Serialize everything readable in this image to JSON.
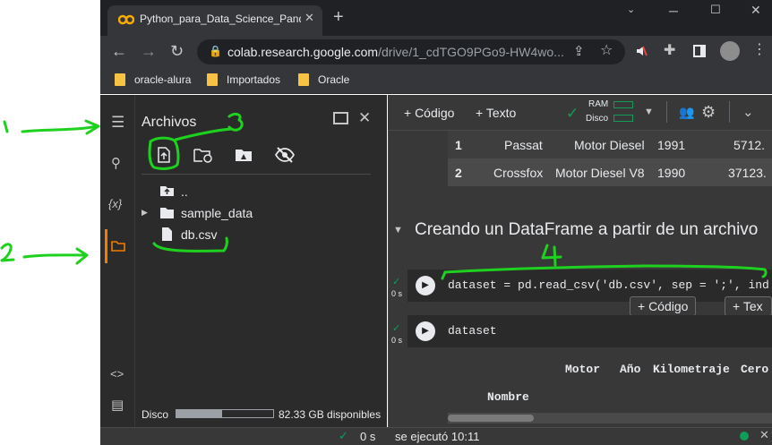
{
  "browser": {
    "tab_title": "Python_para_Data_Science_Pandas",
    "new_tab": "+",
    "url_host": "colab.research.google.com",
    "url_path": "/drive/1_cdTGO9PGo9-HW4wo...",
    "bookmarks": [
      "oracle-alura",
      "Importados",
      "Oracle"
    ]
  },
  "files_panel": {
    "title": "Archivos",
    "tree": [
      {
        "label": "..",
        "icon": "folder-up-icon"
      },
      {
        "label": "sample_data",
        "icon": "folder-icon"
      },
      {
        "label": "db.csv",
        "icon": "file-icon"
      }
    ],
    "disk_label": "Disco",
    "disk_available": "82.33 GB disponibles",
    "disk_used_fraction": 0.47
  },
  "main_toolbar": {
    "add_code": "+ Código",
    "add_text": "+ Texto",
    "ram_label": "RAM",
    "disk_label": "Disco"
  },
  "table_top": {
    "rows": [
      {
        "idx": "1",
        "name": "Passat",
        "motor": "Motor Diesel",
        "year": "1991",
        "km": "5712."
      },
      {
        "idx": "2",
        "name": "Crossfox",
        "motor": "Motor Diesel V8",
        "year": "1990",
        "km": "37123."
      }
    ]
  },
  "section_heading": "Creando un DataFrame a partir de un archivo",
  "cells": [
    {
      "code": "dataset = pd.read_csv('db.csv', sep = ';', ind",
      "status": "0 s"
    },
    {
      "code": "dataset",
      "status": "0 s"
    }
  ],
  "cell_toolbar": {
    "add_code": "+ Código",
    "add_text": "+ Tex"
  },
  "output_header": {
    "columns": [
      "Motor",
      "Año",
      "Kilometraje",
      "Cero"
    ],
    "index_name": "Nombre"
  },
  "annotations": [
    "1",
    "2",
    "3",
    "4"
  ],
  "status_bar": {
    "elapsed": "0 s",
    "message": "se ejecutó 10:11"
  },
  "colors": {
    "accent_orange": "#f57c00",
    "annotation_green": "#1fd11f",
    "check_green": "#0f9d58"
  }
}
